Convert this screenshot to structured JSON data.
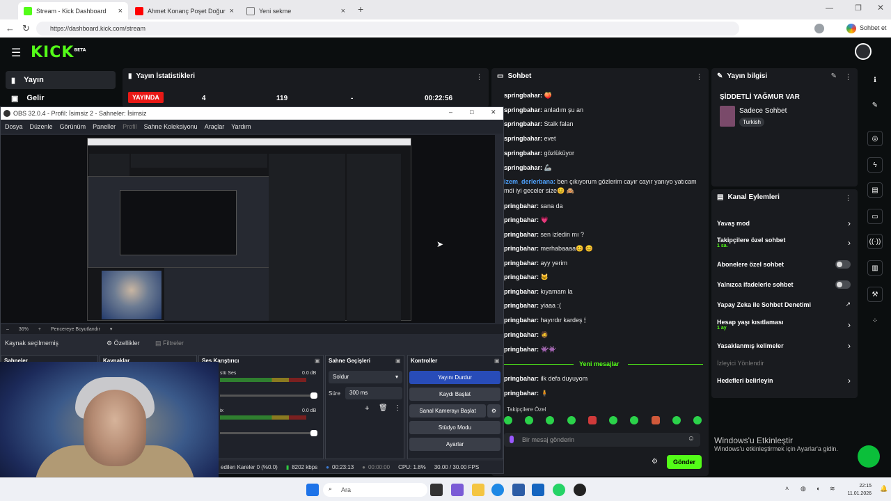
{
  "browser": {
    "tabs": [
      {
        "label": "Stream - Kick Dashboard",
        "color": "#53fc18"
      },
      {
        "label": "Ahmet Konanç Poşet Doğurdu Fe",
        "color": "#ff0000"
      },
      {
        "label": "Yeni sekme",
        "color": "#777777"
      }
    ],
    "url": "https://dashboard.kick.com/stream",
    "profile_label": "Sohbet et"
  },
  "kick": {
    "logo": "KICK",
    "logo_badge": "BETA",
    "sidebar": [
      {
        "label": "Yayın",
        "icon": "broadcast-icon"
      },
      {
        "label": "Gelir",
        "icon": "revenue-icon"
      }
    ],
    "stats": {
      "title": "Yayın İstatistikleri",
      "live_label": "YAYINDA",
      "viewers": "4",
      "followers": "119",
      "extra": "-",
      "duration": "00:22:56"
    },
    "chat": {
      "title": "Sohbet",
      "messages": [
        {
          "user": "springbahar:",
          "text": "🍑"
        },
        {
          "user": "springbahar:",
          "text": "anladım şu an"
        },
        {
          "user": "springbahar:",
          "text": "Stalk falan"
        },
        {
          "user": "springbahar:",
          "text": "evet"
        },
        {
          "user": "springbahar:",
          "text": "gözlüküyor"
        },
        {
          "user": "springbahar:",
          "text": "🦾"
        },
        {
          "user": "izem_derlerbana:",
          "text": "ben çıkıyorum gözlerim cayır cayır yanıyo yatıcam"
        },
        {
          "user": "",
          "text": "mdi iyi geceler size😊 🙈"
        },
        {
          "user": "pringbahar:",
          "text": "sana da"
        },
        {
          "user": "pringbahar:",
          "text": "💗"
        },
        {
          "user": "pringbahar:",
          "text": "sen izledin mı ?"
        },
        {
          "user": "pringbahar:",
          "text": "merhabaaaa😊 😊"
        },
        {
          "user": "pringbahar:",
          "text": "ayy yerim"
        },
        {
          "user": "pringbahar:",
          "text": "🐱"
        },
        {
          "user": "pringbahar:",
          "text": "kıyamam la"
        },
        {
          "user": "pringbahar:",
          "text": "yiaaa :("
        },
        {
          "user": "pringbahar:",
          "text": "hayırdır kardeş 🕯"
        },
        {
          "user": "pringbahar:",
          "text": "🧔"
        },
        {
          "user": "pringbahar:",
          "text": "👾👾"
        }
      ],
      "new_messages_label": "Yeni mesajlar",
      "after_messages": [
        {
          "user": "pringbahar:",
          "text": "ilk defa duyuyom"
        },
        {
          "user": "pringbahar:",
          "text": "🧍"
        }
      ],
      "followers_only_label": "Takipçilere Özel",
      "input_placeholder": "Bir mesaj gönderin",
      "send_label": "Gönder"
    },
    "stream_info": {
      "title": "Yayın bilgisi",
      "stream_title": "ŞİDDETLİ YAĞMUR VAR",
      "category": "Sadece Sohbet",
      "language": "Turkish"
    },
    "channel_actions": {
      "title": "Kanal Eylemleri",
      "items": [
        {
          "label": "Yavaş mod",
          "sub": "",
          "control": "chevron"
        },
        {
          "label": "Takipçilere özel sohbet",
          "sub": "1 sa.",
          "control": "chevron"
        },
        {
          "label": "Abonelere özel sohbet",
          "sub": "",
          "control": "toggle"
        },
        {
          "label": "Yalnızca ifadelerle sohbet",
          "sub": "",
          "control": "toggle"
        },
        {
          "label": "Yapay Zeka ile Sohbet Denetimi",
          "sub": "",
          "control": "external"
        },
        {
          "label": "Hesap yaşı kısıtlaması",
          "sub": "1 ay",
          "control": "chevron"
        },
        {
          "label": "Yasaklanmış kelimeler",
          "sub": "",
          "control": "chevron"
        },
        {
          "label": "İzleyici Yönlendir",
          "sub": "",
          "control": "none"
        },
        {
          "label": "Hedefleri belirleyin",
          "sub": "",
          "control": "chevron"
        }
      ]
    }
  },
  "obs": {
    "title": "OBS 32.0.4 - Profil: İsimsiz 2 - Sahneler: İsimsiz",
    "menu": [
      "Dosya",
      "Düzenle",
      "Görünüm",
      "Paneller",
      "Profil",
      "Sahne Koleksiyonu",
      "Araçlar",
      "Yardım"
    ],
    "zoom": "36%",
    "fit_label": "Pencereye Boyutlandır",
    "no_source": "Kaynak seçilmemiş",
    "properties": "Özellikler",
    "filters": "Filtreler",
    "docks": {
      "scenes": "Sahneler",
      "sources": "Kaynaklar",
      "mixer": "Ses Karıştırıcı",
      "transitions": "Sahne Geçişleri",
      "controls": "Kontroller"
    },
    "mixer": [
      {
        "name": "stü Ses",
        "db": "0.0 dB"
      },
      {
        "name": "ix",
        "db": "0.0 dB"
      }
    ],
    "transition": {
      "type": "Soldur",
      "duration_label": "Süre",
      "duration": "300 ms"
    },
    "controls": [
      "Yayını Durdur",
      "Kaydı Başlat",
      "Sanal Kamerayı Başlat",
      "Stüdyo Modu",
      "Ayarlar"
    ],
    "status": {
      "dropped": "edilen Kareler 0 (%0.0)",
      "bitrate": "8202 kbps",
      "stream_time": "00:23:13",
      "rec_time": "00:00:00",
      "cpu": "CPU: 1.8%",
      "fps": "30.00 / 30.00 FPS"
    }
  },
  "windows": {
    "activation_title": "Windows'u Etkinleştir",
    "activation_sub": "Windows'u etkinleştirmek için Ayarlar'a gidin.",
    "search_label": "Ara",
    "time": "22:15",
    "date": "11.01.2026"
  }
}
